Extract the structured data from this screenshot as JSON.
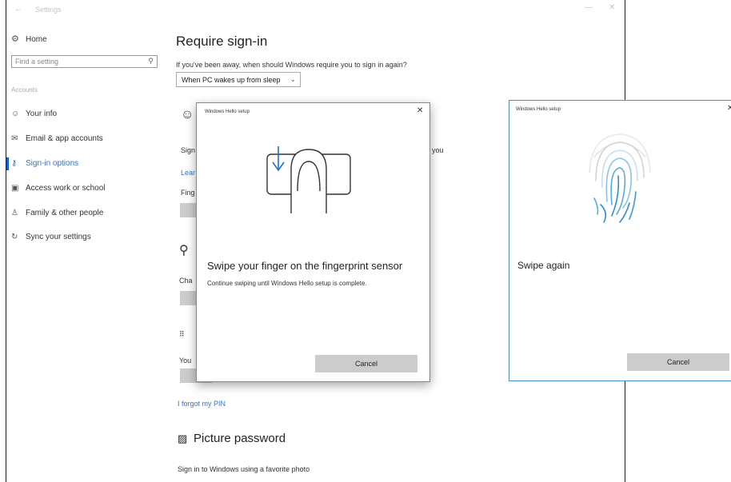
{
  "window": {
    "title": "Settings",
    "back_icon": "back-arrow-icon"
  },
  "nav": {
    "home_label": "Home",
    "search_placeholder": "Find a setting",
    "section_label": "Accounts",
    "items": [
      {
        "label": "Your info",
        "icon": "person-card-icon"
      },
      {
        "label": "Email & app accounts",
        "icon": "mail-icon"
      },
      {
        "label": "Sign-in options",
        "icon": "key-icon",
        "active": true
      },
      {
        "label": "Access work or school",
        "icon": "briefcase-icon"
      },
      {
        "label": "Family & other people",
        "icon": "people-icon"
      },
      {
        "label": "Sync your settings",
        "icon": "sync-icon"
      }
    ]
  },
  "main": {
    "require_signin_title": "Require sign-in",
    "require_signin_prompt": "If you've been away, when should Windows require you to sign in again?",
    "require_signin_value": "When PC wakes up from sleep",
    "frag_sign": "Sign",
    "frag_you": "you",
    "frag_lear": "Lear",
    "frag_fing": "Fing",
    "frag_cha": "Cha",
    "frag_you2": "You",
    "forgot_pin": "I forgot my PIN",
    "picture_password_title": "Picture password",
    "picture_password_desc": "Sign in to Windows using a favorite photo"
  },
  "dialog_swipe": {
    "title": "Windows Hello setup",
    "heading": "Swipe your finger on the fingerprint sensor",
    "description": "Continue swiping until Windows Hello setup is complete.",
    "cancel_label": "Cancel"
  },
  "dialog_again": {
    "title": "Windows Hello setup",
    "heading": "Swipe again",
    "cancel_label": "Cancel"
  },
  "colors": {
    "accent": "#0b62c9",
    "link": "#3a72c4",
    "fingerprint": "#2b8fd6",
    "arrow": "#1e73c8"
  }
}
